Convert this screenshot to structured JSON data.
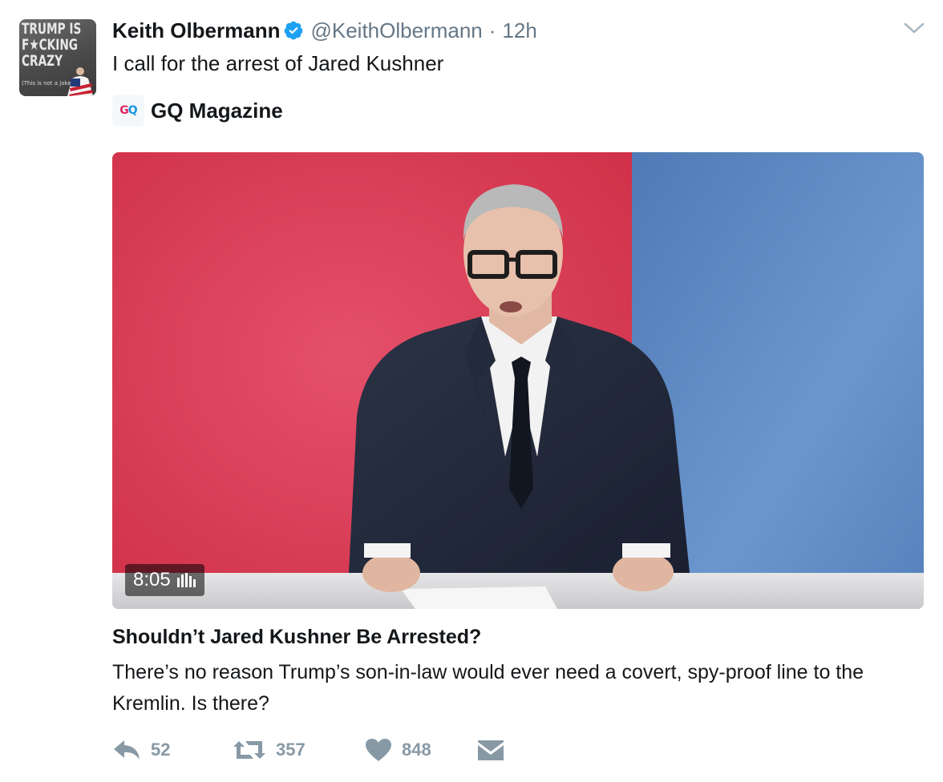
{
  "author": {
    "name": "Keith Olbermann",
    "handle": "@KeithOlbermann",
    "separator": "·",
    "time": "12h",
    "avatar": {
      "line1": "TRUMP IS",
      "line2": "F★CKING",
      "line3": "CRAZY",
      "line4": "(This is not a joke)"
    }
  },
  "tweet": {
    "text": "I call for the arrest of Jared Kushner"
  },
  "card": {
    "source_name": "GQ Magazine",
    "source_logo": "GQ",
    "duration": "8:05",
    "title": "Shouldn’t Jared Kushner Be Arrested?",
    "description": "There’s no reason Trump’s son-in-law would ever need a covert, spy-proof line to the Kremlin. Is there?"
  },
  "actions": {
    "replies": "52",
    "retweets": "357",
    "likes": "848"
  },
  "colors": {
    "verified": "#1da1f2",
    "muted": "#657786",
    "action": "#8899a6",
    "backdrop_red": "#d9384f",
    "backdrop_blue": "#5683bd"
  }
}
